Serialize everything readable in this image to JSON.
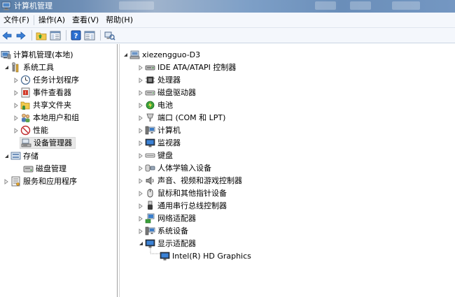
{
  "window": {
    "title": "计算机管理"
  },
  "menu": [
    "文件(F)",
    "操作(A)",
    "查看(V)",
    "帮助(H)"
  ],
  "left_tree": {
    "root": "计算机管理(本地)",
    "system_tools": "系统工具",
    "system_tools_items": [
      "任务计划程序",
      "事件查看器",
      "共享文件夹",
      "本地用户和组",
      "性能",
      "设备管理器"
    ],
    "storage": "存储",
    "storage_items": [
      "磁盘管理"
    ],
    "services": "服务和应用程序"
  },
  "device_tree": {
    "root": "xiezengguo-D3",
    "categories": [
      "IDE ATA/ATAPI 控制器",
      "处理器",
      "磁盘驱动器",
      "电池",
      "端口 (COM 和 LPT)",
      "计算机",
      "监视器",
      "键盘",
      "人体学输入设备",
      "声音、视频和游戏控制器",
      "鼠标和其他指针设备",
      "通用串行总线控制器",
      "网络适配器",
      "系统设备",
      "显示适配器"
    ],
    "display_adapter_child": "Intel(R) HD Graphics"
  }
}
